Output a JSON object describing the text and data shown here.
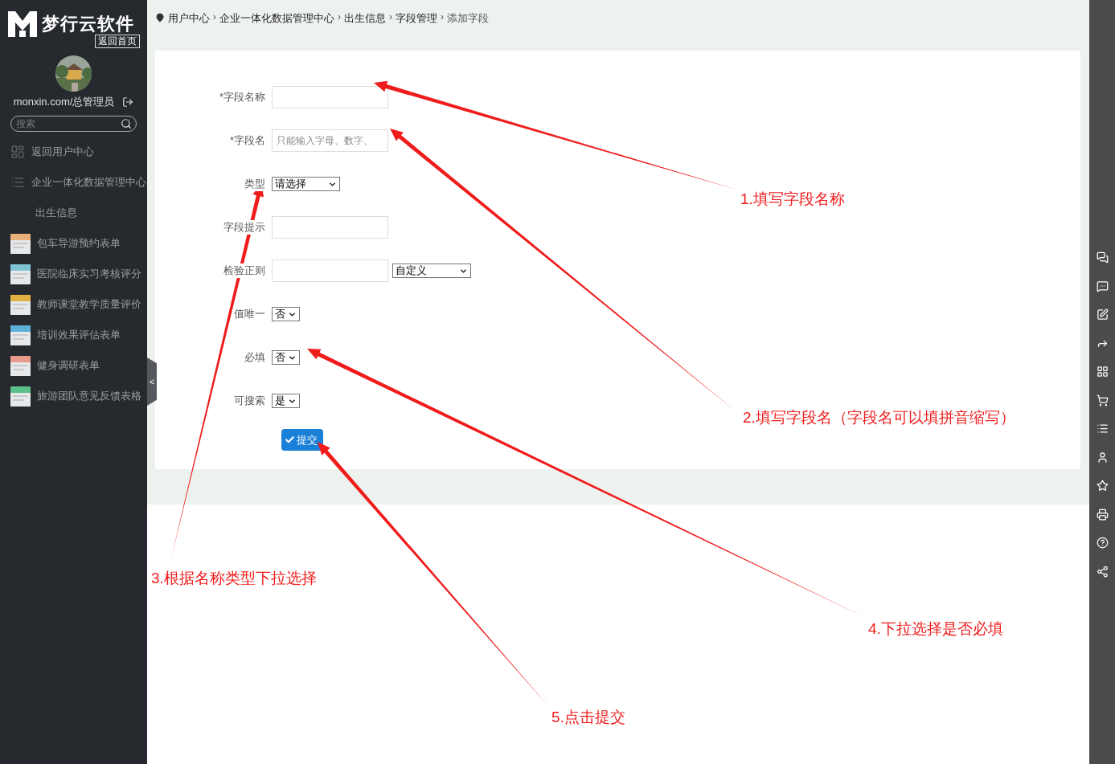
{
  "sidebar": {
    "logo": "梦行云软件",
    "home_link": "返回首页",
    "user": "monxin.com/总管理员",
    "search": {
      "placeholder": "搜索"
    },
    "items": [
      {
        "label": "返回用户中心",
        "kind": "grid"
      },
      {
        "label": "企业一体化数据管理中心",
        "kind": "list"
      },
      {
        "label": "出生信息",
        "kind": "plain"
      },
      {
        "label": "包车导游预约表单",
        "kind": "thumb",
        "color": "#e8b07a"
      },
      {
        "label": "医院临床实习考核评分",
        "kind": "thumb",
        "color": "#7ec4d4"
      },
      {
        "label": "教师课堂教学质量评价",
        "kind": "thumb",
        "color": "#e0b040"
      },
      {
        "label": "培训效果评估表单",
        "kind": "thumb",
        "color": "#5fb0d8"
      },
      {
        "label": "健身调研表单",
        "kind": "thumb",
        "color": "#e89a8a"
      },
      {
        "label": "旅游团队意见反馈表格",
        "kind": "thumb",
        "color": "#5cc08a"
      }
    ],
    "collapse_toggle": "<"
  },
  "breadcrumb": [
    {
      "label": "用户中心"
    },
    {
      "separator": "›",
      "label": "企业一体化数据管理中心"
    },
    {
      "separator": "›",
      "label": "出生信息"
    },
    {
      "separator": "›",
      "label": "字段管理"
    },
    {
      "separator": "›",
      "label": "添加字段"
    }
  ],
  "form": {
    "fields": [
      {
        "label": "*字段名称",
        "kind": "text"
      },
      {
        "label": "*字段名",
        "kind": "text",
        "placeholder": "只能输入字母、数字、"
      },
      {
        "label": "类型",
        "kind": "select",
        "value": "请选择"
      },
      {
        "label": "字段提示",
        "kind": "text"
      },
      {
        "label": "检验正则",
        "kind": "text",
        "extra_select": "自定义"
      },
      {
        "label": "值唯一",
        "kind": "select",
        "value": "否"
      },
      {
        "label": "必填",
        "kind": "select",
        "value": "否"
      },
      {
        "label": "可搜索",
        "kind": "select",
        "value": "是"
      }
    ],
    "submit": "提交"
  },
  "annotations": [
    "1.填写字段名称",
    "2.填写字段名（字段名可以填拼音缩写）",
    "3.根据名称类型下拉选择",
    "4.下拉选择是否必填",
    "5.点击提交"
  ]
}
